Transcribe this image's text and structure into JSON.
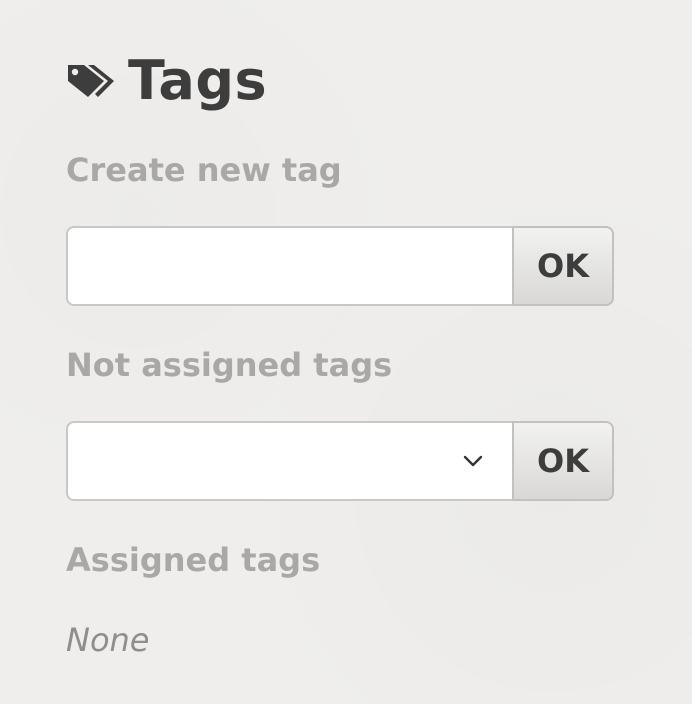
{
  "heading": {
    "title": "Tags",
    "icon": "tag-icon"
  },
  "create": {
    "label": "Create new tag",
    "value": "",
    "placeholder": "",
    "ok_label": "OK"
  },
  "not_assigned": {
    "label": "Not assigned tags",
    "selected": "",
    "icon": "chevron-down-icon",
    "ok_label": "OK"
  },
  "assigned": {
    "label": "Assigned tags",
    "value": "None"
  },
  "colors": {
    "heading": "#3d3d3d",
    "label": "#a9a8a6",
    "background": "#efeeec"
  }
}
